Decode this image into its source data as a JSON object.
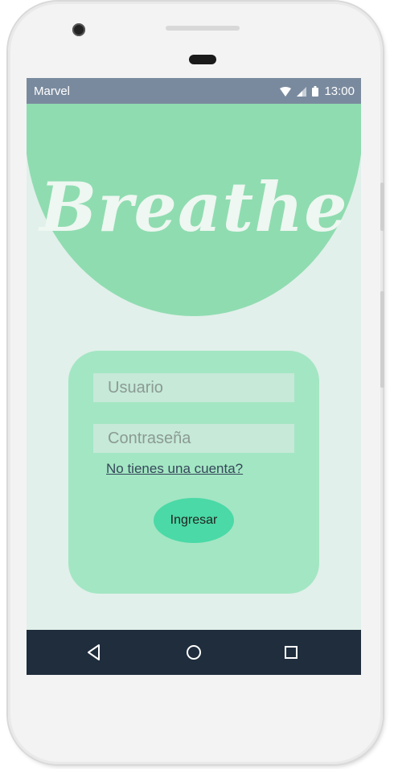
{
  "status_bar": {
    "carrier": "Marvel",
    "time": "13:00",
    "icons": [
      "wifi-icon",
      "signal-icon",
      "battery-icon"
    ]
  },
  "header": {
    "logo_text": "Breathe"
  },
  "login": {
    "username_placeholder": "Usuario",
    "password_placeholder": "Contraseña",
    "signup_link": "No tienes una cuenta?",
    "submit_label": "Ingresar"
  },
  "nav_bar": {
    "icons": [
      "back-icon",
      "home-icon",
      "recents-icon"
    ]
  },
  "colors": {
    "status_bar": "#7a8a9e",
    "header": "#8fdcb0",
    "background": "#e1f0ea",
    "card": "#a3e6c3",
    "field": "#c6e9d8",
    "button": "#4ad9a7",
    "nav_bar": "#1f2d3d"
  }
}
